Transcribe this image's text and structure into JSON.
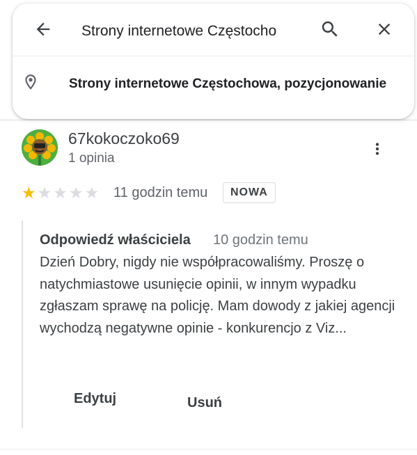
{
  "search": {
    "query": "Strony internetowe Częstocho",
    "suggestion": "Strony internetowe Częstochowa, pozycjonowanie"
  },
  "icons": {
    "back": "arrow-back-icon",
    "search": "search-icon",
    "close": "close-icon",
    "place": "location-pin-icon",
    "more": "more-vert-icon"
  },
  "review": {
    "author": "67kokoczoko69",
    "author_meta": "1 opinia",
    "rating": 1,
    "rating_max": 5,
    "time": "11 godzin temu",
    "badge": "NOWA"
  },
  "reply": {
    "author": "Odpowiedź właściciela",
    "time": "10 godzin temu",
    "text": "Dzień Dobry, nigdy nie współpracowaliśmy. Proszę o natychmiastowe usunięcie opinii, w innym wypadku zgłaszam sprawę na policję. Mam dowody z jakiej agencji wychodzą negatywne opinie - konkurencjo z Viz...",
    "edit_label": "Edytuj",
    "delete_label": "Usuń"
  },
  "colors": {
    "star_on": "#fbbc04",
    "star_off": "#dadce0",
    "text": "#3c4043"
  }
}
